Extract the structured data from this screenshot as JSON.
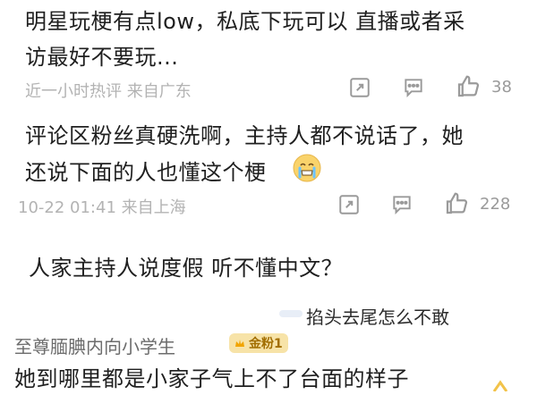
{
  "comments": [
    {
      "text_line1": "明星玩梗有点low，私底下玩可以 直播或者采",
      "text_line2": "访最好不要玩...",
      "meta": "近一小时热评 来自广东",
      "likes": "38"
    },
    {
      "text_line1": "评论区粉丝真硬洗啊，主持人都不说话了，她",
      "text_line2": "还说下面的人也懂这个梗",
      "meta": "10-22 01:41 来自上海",
      "likes": "228"
    },
    {
      "text_line1": "人家主持人说度假 听不懂中文？",
      "reply_author_short": "掐头去尾怎么不敢"
    },
    {
      "username": "至尊腼腆内向小学生",
      "badge": "金粉1",
      "text_line1": "她到哪里都是小家子气上不了台面的样子"
    }
  ],
  "icons": {
    "share": "share-icon",
    "comment": "comment-icon",
    "like": "thumbs-up-icon",
    "emoji": "crying-emoji-icon"
  }
}
